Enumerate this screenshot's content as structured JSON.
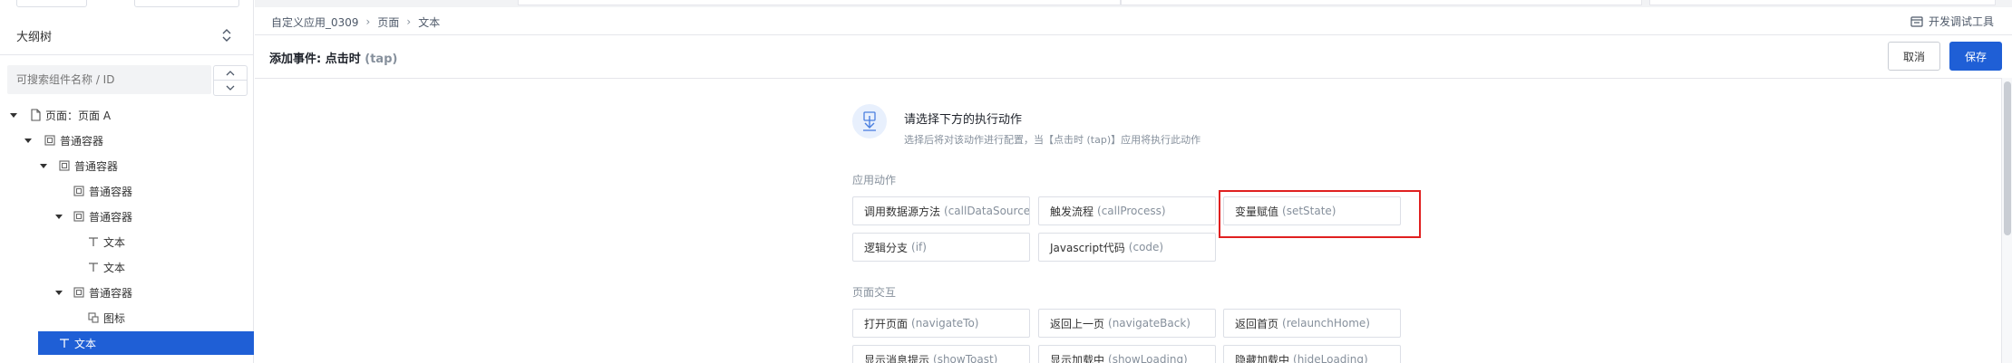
{
  "outline": {
    "title": "大纲树",
    "search_placeholder": "可搜索组件名称 / ID",
    "tree": [
      {
        "label": "页面：页面 A",
        "depth": 0,
        "caret": "down",
        "icon": "page-icon"
      },
      {
        "label": "普通容器",
        "depth": 1,
        "caret": "down",
        "icon": "container-icon"
      },
      {
        "label": "普通容器",
        "depth": 2,
        "caret": "down",
        "icon": "container-icon"
      },
      {
        "label": "普通容器",
        "depth": 3,
        "caret": "none",
        "icon": "container-icon"
      },
      {
        "label": "普通容器",
        "depth": 3,
        "caret": "down",
        "icon": "container-icon"
      },
      {
        "label": "文本",
        "depth": 4,
        "caret": "none",
        "icon": "text-icon"
      },
      {
        "label": "文本",
        "depth": 4,
        "caret": "none",
        "icon": "text-icon"
      },
      {
        "label": "普通容器",
        "depth": 3,
        "caret": "down",
        "icon": "container-icon"
      },
      {
        "label": "图标",
        "depth": 4,
        "caret": "none",
        "icon": "icon-component-icon"
      },
      {
        "label": "文本",
        "depth": 2,
        "caret": "none",
        "icon": "text-icon",
        "selected": true
      }
    ]
  },
  "breadcrumb": [
    "自定义应用_0309",
    "页面",
    "文本"
  ],
  "devtools_label": "开发调试工具",
  "dialog": {
    "title": "添加事件: 点击时",
    "title_tag": "(tap)",
    "cancel_label": "取消",
    "save_label": "保存"
  },
  "hint": {
    "title": "请选择下方的执行动作",
    "subtitle": "选择后将对该动作进行配置，当【点击时 (tap)】应用将执行此动作"
  },
  "sections": [
    {
      "label": "应用动作",
      "actions": [
        {
          "name": "调用数据源方法",
          "code": "(callDataSource)"
        },
        {
          "name": "触发流程",
          "code": "(callProcess)"
        },
        {
          "name": "变量赋值",
          "code": "(setState)",
          "highlighted": true
        },
        {
          "name": "逻辑分支",
          "code": "(if)"
        },
        {
          "name": "Javascript代码",
          "code": "(code)"
        }
      ]
    },
    {
      "label": "页面交互",
      "actions": [
        {
          "name": "打开页面",
          "code": "(navigateTo)"
        },
        {
          "name": "返回上一页",
          "code": "(navigateBack)"
        },
        {
          "name": "返回首页",
          "code": "(relaunchHome)"
        },
        {
          "name": "显示消息提示",
          "code": "(showToast)"
        },
        {
          "name": "显示加载中",
          "code": "(showLoading)"
        },
        {
          "name": "隐藏加载中",
          "code": "(hideLoading)"
        }
      ]
    }
  ],
  "colors": {
    "primary": "#1f5fd6",
    "highlight_border": "#e02020",
    "muted_text": "#86909c"
  }
}
